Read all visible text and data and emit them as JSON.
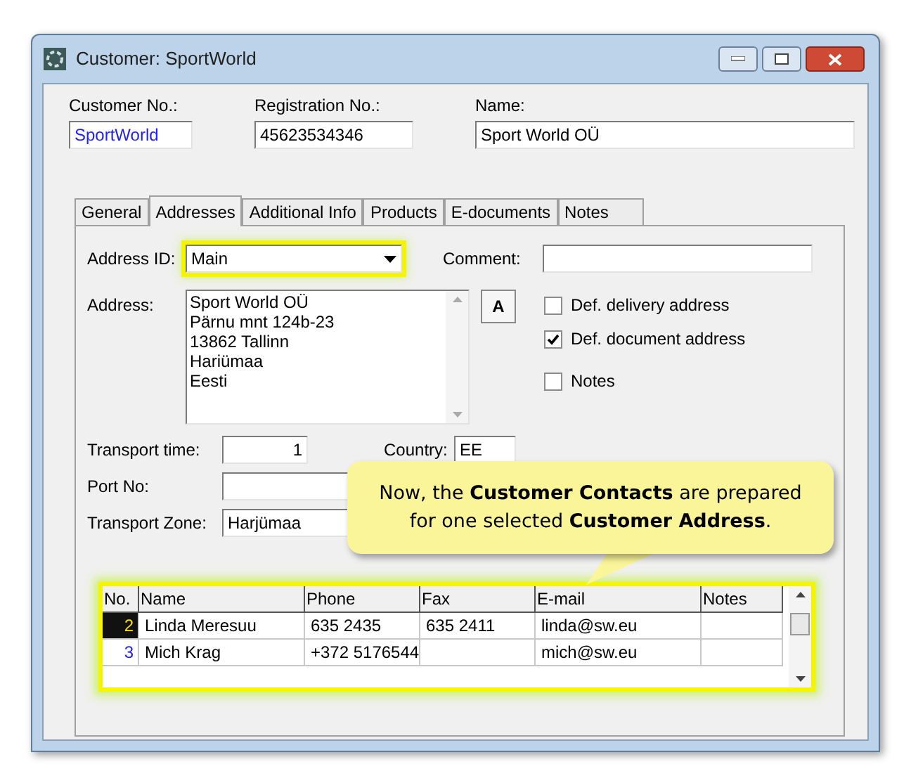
{
  "window": {
    "title": "Customer: SportWorld"
  },
  "header_fields": [
    {
      "label": "Customer No.:",
      "value": "SportWorld",
      "kind": "link"
    },
    {
      "label": "Registration No.:",
      "value": "45623534346",
      "kind": "text"
    },
    {
      "label": "Name:",
      "value": "Sport World OÜ",
      "kind": "text"
    }
  ],
  "tabs": [
    {
      "label": "General",
      "selected": false
    },
    {
      "label": "Addresses",
      "selected": true
    },
    {
      "label": "Additional Info",
      "selected": false
    },
    {
      "label": "Products",
      "selected": false
    },
    {
      "label": "E-documents",
      "selected": false
    },
    {
      "label": "Notes",
      "selected": false
    }
  ],
  "address_id": {
    "label": "Address ID:",
    "value": "Main",
    "highlighted": true
  },
  "comment": {
    "label": "Comment:"
  },
  "address": {
    "label": "Address:",
    "lines": [
      "Sport World OÜ",
      "Pärnu mnt 124b-23",
      "13862 Tallinn",
      "Hariümaa",
      "Eesti"
    ],
    "button": "A"
  },
  "checkboxes": [
    {
      "label": "Def. delivery address",
      "checked": false
    },
    {
      "label": "Def. document address",
      "checked": true
    },
    {
      "label": "Notes",
      "checked": false
    }
  ],
  "transport_time": {
    "label": "Transport time:",
    "value": "1"
  },
  "country": {
    "label": "Country:",
    "value": "EE"
  },
  "port_no": {
    "label": "Port No:"
  },
  "transport_zone": {
    "label": "Transport Zone:",
    "value": "Harjümaa"
  },
  "callout": {
    "text": "Now, the **Customer Contacts** are prepared for one selected **Customer Address**."
  },
  "contacts": {
    "highlighted": true,
    "columns": [
      "No.",
      "Name",
      "Phone",
      "Fax",
      "E-mail",
      "Notes"
    ],
    "rows": [
      {
        "selected": true,
        "cells": [
          "2",
          "Linda Meresuu",
          "635 2435",
          "635 2411",
          "linda@sw.eu",
          ""
        ]
      },
      {
        "selected": false,
        "cells": [
          "3",
          "Mich Krag",
          "+372 5176544",
          "",
          "mich@sw.eu",
          ""
        ]
      }
    ]
  }
}
